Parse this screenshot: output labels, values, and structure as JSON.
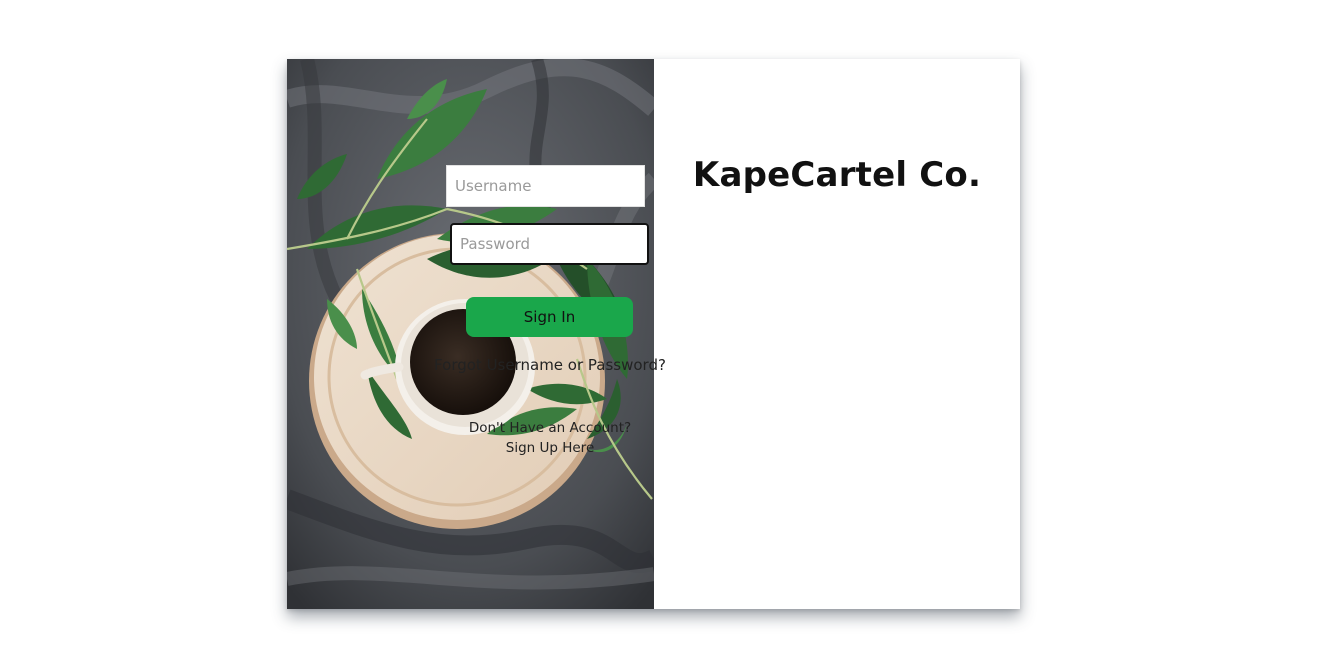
{
  "brand": {
    "name": "KapeCartel Co."
  },
  "form": {
    "username_placeholder": "Username",
    "password_placeholder": "Password",
    "signin_label": "Sign In",
    "forgot_label": "Forgot Username or Password?",
    "signup_prompt": "Don't Have an Account?",
    "signup_link": "Sign Up Here"
  },
  "colors": {
    "accent": "#1aa74b",
    "text": "#111111",
    "border": "#e2e2e2"
  },
  "hero_image": {
    "icon": "coffee-cup-leaves-image"
  }
}
